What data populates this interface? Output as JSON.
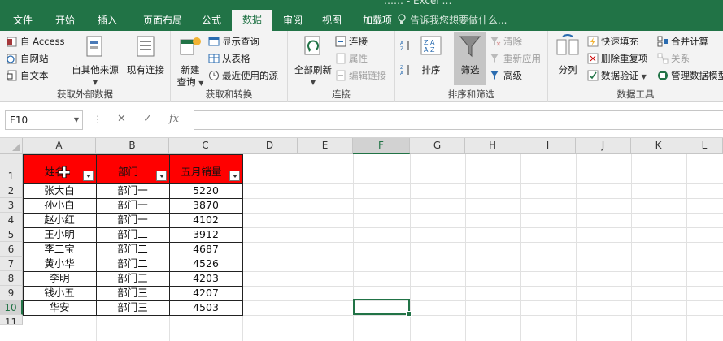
{
  "window": {
    "title_fragment": "…… - Excel …"
  },
  "tabs": [
    "文件",
    "开始",
    "插入",
    "页面布局",
    "公式",
    "数据",
    "审阅",
    "视图",
    "加载项"
  ],
  "active_tab": "数据",
  "tell_me": "告诉我您想要做什么...",
  "ribbon": {
    "get_external": {
      "label": "获取外部数据",
      "from_access": "自 Access",
      "from_web": "自网站",
      "from_text": "自文本",
      "from_other": "自其他来源",
      "existing": "现有连接"
    },
    "get_transform": {
      "label": "获取和转换",
      "new_query": "新建\n查询",
      "show_queries": "显示查询",
      "from_table": "从表格",
      "recent_sources": "最近使用的源"
    },
    "connections": {
      "label": "连接",
      "refresh_all": "全部刷新",
      "connections": "连接",
      "properties": "属性",
      "edit_links": "编辑链接"
    },
    "sort_filter": {
      "label": "排序和筛选",
      "sort": "排序",
      "filter": "筛选",
      "clear": "清除",
      "reapply": "重新应用",
      "advanced": "高级"
    },
    "data_tools": {
      "label": "数据工具",
      "text_to_columns": "分列",
      "flash_fill": "快速填充",
      "remove_dup": "删除重复项",
      "validation": "数据验证",
      "consolidate": "合并计算",
      "relationships": "关系",
      "manage_model": "管理数据模型"
    }
  },
  "formula_bar": {
    "name_box": "F10",
    "fx": "fx",
    "cancel": "✕",
    "enter": "✓",
    "content": ""
  },
  "columns": [
    "A",
    "B",
    "C",
    "D",
    "E",
    "F",
    "G",
    "H",
    "I",
    "J",
    "K",
    "L"
  ],
  "rows": [
    "1",
    "2",
    "3",
    "4",
    "5",
    "6",
    "7",
    "8",
    "9",
    "10",
    "11"
  ],
  "selected_cell": "F10",
  "table": {
    "headers": [
      "姓名",
      "部门",
      "五月销量"
    ],
    "rows": [
      [
        "张大白",
        "部门一",
        "5220"
      ],
      [
        "孙小白",
        "部门一",
        "3870"
      ],
      [
        "赵小红",
        "部门一",
        "4102"
      ],
      [
        "王小明",
        "部门二",
        "3912"
      ],
      [
        "李二宝",
        "部门二",
        "4687"
      ],
      [
        "黄小华",
        "部门二",
        "4526"
      ],
      [
        "李明",
        "部门三",
        "4203"
      ],
      [
        "钱小五",
        "部门三",
        "4207"
      ],
      [
        "华安",
        "部门三",
        "4503"
      ]
    ]
  },
  "colors": {
    "accent": "#217346",
    "header_fill": "#ff0000"
  }
}
